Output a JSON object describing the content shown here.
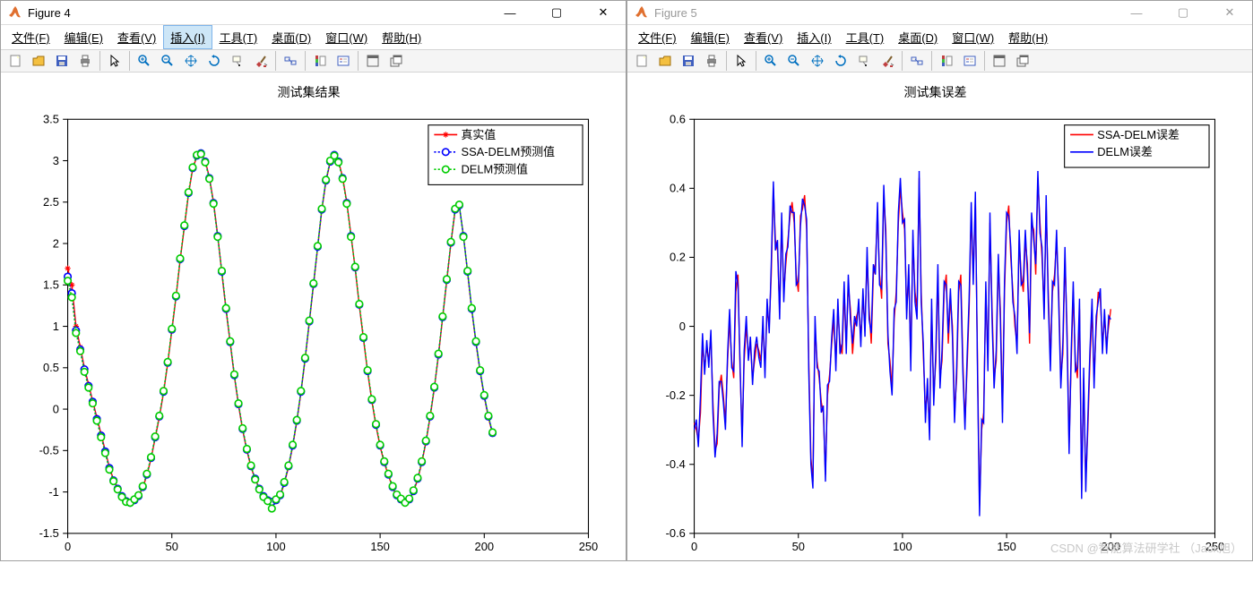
{
  "windows": [
    {
      "title": "Figure 4",
      "active": true,
      "plot_title": "测试集结果",
      "legend": [
        "真实值",
        "SSA-DELM预测值",
        "DELM预测值"
      ]
    },
    {
      "title": "Figure 5",
      "active": false,
      "plot_title": "测试集误差",
      "legend": [
        "SSA-DELM误差",
        "DELM误差"
      ]
    }
  ],
  "menu": {
    "file": "文件(F)",
    "edit": "编辑(E)",
    "view": "查看(V)",
    "insert": "插入(I)",
    "tools": "工具(T)",
    "desktop": "桌面(D)",
    "window": "窗口(W)",
    "help": "帮助(H)"
  },
  "win_controls": {
    "min": "—",
    "max": "▢",
    "close": "✕"
  },
  "watermark": "CSDN @智能算法研学社 （Jack旭）",
  "chart_data": [
    {
      "type": "line",
      "title": "测试集结果",
      "xlabel": "",
      "ylabel": "",
      "xlim": [
        0,
        250
      ],
      "ylim": [
        -1.5,
        3.5
      ],
      "xticks": [
        0,
        50,
        100,
        150,
        200,
        250
      ],
      "yticks": [
        -1.5,
        -1,
        -0.5,
        0,
        0.5,
        1,
        1.5,
        2,
        2.5,
        3,
        3.5
      ],
      "x": [
        0,
        2,
        4,
        6,
        8,
        10,
        12,
        14,
        16,
        18,
        20,
        22,
        24,
        26,
        28,
        30,
        32,
        34,
        36,
        38,
        40,
        42,
        44,
        46,
        48,
        50,
        52,
        54,
        56,
        58,
        60,
        62,
        64,
        66,
        68,
        70,
        72,
        74,
        76,
        78,
        80,
        82,
        84,
        86,
        88,
        90,
        92,
        94,
        96,
        98,
        100,
        102,
        104,
        106,
        108,
        110,
        112,
        114,
        116,
        118,
        120,
        122,
        124,
        126,
        128,
        130,
        132,
        134,
        136,
        138,
        140,
        142,
        144,
        146,
        148,
        150,
        152,
        154,
        156,
        158,
        160,
        162,
        164,
        166,
        168,
        170,
        172,
        174,
        176,
        178,
        180,
        182,
        184,
        186,
        188,
        190,
        192,
        194,
        196,
        198,
        200,
        202,
        204
      ],
      "series": [
        {
          "name": "真实值",
          "color": "#ff0000",
          "marker": "*",
          "values": [
            1.7,
            1.5,
            1.0,
            0.75,
            0.5,
            0.3,
            0.1,
            -0.1,
            -0.3,
            -0.5,
            -0.7,
            -0.85,
            -0.95,
            -1.05,
            -1.1,
            -1.12,
            -1.1,
            -1.05,
            -0.95,
            -0.8,
            -0.6,
            -0.35,
            -0.1,
            0.2,
            0.55,
            0.95,
            1.35,
            1.8,
            2.2,
            2.6,
            2.9,
            3.05,
            3.1,
            3.0,
            2.8,
            2.5,
            2.1,
            1.65,
            1.2,
            0.8,
            0.4,
            0.05,
            -0.25,
            -0.5,
            -0.7,
            -0.85,
            -0.95,
            -1.05,
            -1.1,
            -1.12,
            -1.1,
            -1.05,
            -0.9,
            -0.7,
            -0.45,
            -0.15,
            0.2,
            0.6,
            1.05,
            1.5,
            1.95,
            2.4,
            2.75,
            2.98,
            3.08,
            3.0,
            2.8,
            2.5,
            2.1,
            1.7,
            1.25,
            0.85,
            0.45,
            0.1,
            -0.2,
            -0.45,
            -0.65,
            -0.8,
            -0.95,
            -1.05,
            -1.1,
            -1.12,
            -1.1,
            -1.0,
            -0.85,
            -0.65,
            -0.4,
            -0.1,
            0.25,
            0.65,
            1.1,
            1.55,
            2.0,
            2.4,
            2.45,
            2.1,
            1.65,
            1.2,
            0.8,
            0.45,
            0.15,
            -0.1,
            -0.3
          ]
        },
        {
          "name": "SSA-DELM预测值",
          "color": "#0000ff",
          "marker": "o",
          "linestyle": "dotted",
          "values": [
            1.6,
            1.4,
            0.95,
            0.72,
            0.48,
            0.28,
            0.09,
            -0.12,
            -0.32,
            -0.51,
            -0.71,
            -0.86,
            -0.96,
            -1.05,
            -1.11,
            -1.13,
            -1.1,
            -1.05,
            -0.94,
            -0.79,
            -0.59,
            -0.34,
            -0.09,
            0.21,
            0.56,
            0.96,
            1.36,
            1.81,
            2.21,
            2.61,
            2.91,
            3.06,
            3.09,
            2.99,
            2.79,
            2.49,
            2.09,
            1.66,
            1.21,
            0.81,
            0.41,
            0.06,
            -0.24,
            -0.49,
            -0.69,
            -0.84,
            -0.96,
            -1.05,
            -1.1,
            -1.12,
            -1.1,
            -1.04,
            -0.89,
            -0.69,
            -0.44,
            -0.14,
            0.21,
            0.61,
            1.06,
            1.51,
            1.96,
            2.41,
            2.76,
            2.99,
            3.07,
            2.99,
            2.79,
            2.49,
            2.09,
            1.71,
            1.26,
            0.86,
            0.46,
            0.11,
            -0.19,
            -0.44,
            -0.64,
            -0.79,
            -0.94,
            -1.04,
            -1.09,
            -1.12,
            -1.09,
            -0.99,
            -0.84,
            -0.64,
            -0.39,
            -0.09,
            0.26,
            0.66,
            1.11,
            1.56,
            2.01,
            2.41,
            2.46,
            2.09,
            1.66,
            1.21,
            0.81,
            0.46,
            0.16,
            -0.09,
            -0.29
          ]
        },
        {
          "name": "DELM预测值",
          "color": "#00cc00",
          "marker": "o",
          "linestyle": "dotted",
          "values": [
            1.55,
            1.35,
            0.92,
            0.7,
            0.45,
            0.26,
            0.07,
            -0.14,
            -0.34,
            -0.53,
            -0.73,
            -0.87,
            -0.97,
            -1.06,
            -1.12,
            -1.13,
            -1.09,
            -1.04,
            -0.93,
            -0.78,
            -0.58,
            -0.33,
            -0.08,
            0.22,
            0.57,
            0.97,
            1.37,
            1.82,
            2.22,
            2.62,
            2.92,
            3.07,
            3.08,
            2.98,
            2.78,
            2.48,
            2.08,
            1.67,
            1.22,
            0.82,
            0.42,
            0.07,
            -0.23,
            -0.48,
            -0.68,
            -0.85,
            -0.97,
            -1.06,
            -1.11,
            -1.2,
            -1.09,
            -1.03,
            -0.88,
            -0.68,
            -0.43,
            -0.13,
            0.22,
            0.62,
            1.07,
            1.52,
            1.97,
            2.42,
            2.77,
            3.0,
            3.06,
            2.98,
            2.78,
            2.48,
            2.08,
            1.72,
            1.27,
            0.87,
            0.47,
            0.12,
            -0.18,
            -0.43,
            -0.63,
            -0.78,
            -0.93,
            -1.03,
            -1.08,
            -1.13,
            -1.08,
            -0.98,
            -0.83,
            -0.63,
            -0.38,
            -0.08,
            0.27,
            0.67,
            1.12,
            1.57,
            2.02,
            2.42,
            2.47,
            2.08,
            1.67,
            1.22,
            0.82,
            0.47,
            0.17,
            -0.08,
            -0.28
          ]
        }
      ]
    },
    {
      "type": "line",
      "title": "测试集误差",
      "xlabel": "",
      "ylabel": "",
      "xlim": [
        0,
        250
      ],
      "ylim": [
        -0.6,
        0.6
      ],
      "xticks": [
        0,
        50,
        100,
        150,
        200,
        250
      ],
      "yticks": [
        -0.6,
        -0.4,
        -0.2,
        0,
        0.2,
        0.4,
        0.6
      ],
      "x": [
        0,
        1,
        2,
        3,
        4,
        5,
        6,
        7,
        8,
        9,
        10,
        11,
        12,
        13,
        14,
        15,
        16,
        17,
        18,
        19,
        20,
        21,
        22,
        23,
        24,
        25,
        26,
        27,
        28,
        29,
        30,
        31,
        32,
        33,
        34,
        35,
        36,
        37,
        38,
        39,
        40,
        41,
        42,
        43,
        44,
        45,
        46,
        47,
        48,
        49,
        50,
        51,
        52,
        53,
        54,
        55,
        56,
        57,
        58,
        59,
        60,
        61,
        62,
        63,
        64,
        65,
        66,
        67,
        68,
        69,
        70,
        71,
        72,
        73,
        74,
        75,
        76,
        77,
        78,
        79,
        80,
        81,
        82,
        83,
        84,
        85,
        86,
        87,
        88,
        89,
        90,
        91,
        92,
        93,
        94,
        95,
        96,
        97,
        98,
        99,
        100,
        101,
        102,
        103,
        104,
        105,
        106,
        107,
        108,
        109,
        110,
        111,
        112,
        113,
        114,
        115,
        116,
        117,
        118,
        119,
        120,
        121,
        122,
        123,
        124,
        125,
        126,
        127,
        128,
        129,
        130,
        131,
        132,
        133,
        134,
        135,
        136,
        137,
        138,
        139,
        140,
        141,
        142,
        143,
        144,
        145,
        146,
        147,
        148,
        149,
        150,
        151,
        152,
        153,
        154,
        155,
        156,
        157,
        158,
        159,
        160,
        161,
        162,
        163,
        164,
        165,
        166,
        167,
        168,
        169,
        170,
        171,
        172,
        173,
        174,
        175,
        176,
        177,
        178,
        179,
        180,
        181,
        182,
        183,
        184,
        185,
        186,
        187,
        188,
        189,
        190,
        191,
        192,
        193,
        194,
        195,
        196,
        197,
        198,
        199,
        200
      ],
      "series": [
        {
          "name": "SSA-DELM误差",
          "color": "#ff0000",
          "values": [
            -0.28,
            -0.3,
            -0.33,
            -0.25,
            -0.05,
            -0.12,
            -0.06,
            -0.1,
            -0.03,
            -0.22,
            -0.36,
            -0.34,
            -0.18,
            -0.14,
            -0.2,
            -0.28,
            -0.1,
            0.02,
            -0.1,
            -0.15,
            0.1,
            0.15,
            -0.12,
            -0.32,
            -0.1,
            0.0,
            -0.08,
            -0.05,
            -0.15,
            -0.1,
            -0.05,
            -0.07,
            -0.1,
            0.0,
            -0.12,
            0.05,
            0.0,
            0.15,
            0.4,
            0.25,
            0.22,
            0.05,
            0.3,
            0.1,
            0.18,
            0.25,
            0.32,
            0.36,
            0.3,
            0.15,
            0.1,
            0.32,
            0.34,
            0.38,
            0.28,
            -0.1,
            -0.38,
            -0.45,
            0.0,
            -0.1,
            -0.15,
            -0.22,
            -0.25,
            -0.43,
            -0.2,
            -0.14,
            -0.05,
            0.02,
            -0.1,
            0.05,
            -0.05,
            -0.08,
            0.1,
            -0.05,
            0.12,
            0.05,
            -0.08,
            0.0,
            0.03,
            0.05,
            -0.03,
            0.08,
            0.0,
            0.2,
            0.05,
            -0.05,
            0.15,
            0.18,
            0.33,
            0.15,
            0.08,
            0.38,
            0.28,
            -0.05,
            -0.1,
            -0.18,
            0.02,
            0.1,
            0.3,
            0.4,
            0.33,
            0.28,
            0.05,
            0.15,
            -0.1,
            0.25,
            0.1,
            0.05,
            0.43,
            0.1,
            -0.08,
            -0.25,
            -0.18,
            -0.3,
            0.05,
            -0.2,
            -0.1,
            0.15,
            -0.15,
            -0.1,
            0.1,
            0.15,
            -0.05,
            0.08,
            0.0,
            -0.25,
            -0.15,
            0.1,
            0.15,
            -0.1,
            -0.28,
            -0.12,
            0.05,
            0.33,
            0.15,
            0.36,
            -0.1,
            -0.52,
            -0.3,
            -0.25,
            0.1,
            -0.1,
            0.3,
            0.05,
            -0.15,
            -0.1,
            0.18,
            0.05,
            -0.25,
            0.1,
            0.3,
            0.35,
            0.2,
            0.1,
            0.0,
            -0.05,
            0.25,
            0.15,
            0.1,
            0.25,
            0.18,
            -0.05,
            0.3,
            0.28,
            0.15,
            0.43,
            0.3,
            0.2,
            0.05,
            0.35,
            0.1,
            -0.1,
            0.1,
            0.15,
            0.25,
            0.1,
            -0.15,
            -0.08,
            0.2,
            0.0,
            -0.34,
            -0.1,
            0.1,
            -0.1,
            -0.15,
            0.05,
            -0.48,
            -0.15,
            -0.45,
            -0.3,
            -0.1,
            0.05,
            -0.15,
            0.0,
            0.1,
            0.08,
            -0.05,
            0.02,
            -0.05,
            0.0,
            0.05
          ]
        },
        {
          "name": "DELM误差",
          "color": "#0000ff",
          "values": [
            -0.3,
            -0.27,
            -0.35,
            -0.2,
            -0.02,
            -0.14,
            -0.04,
            -0.12,
            -0.01,
            -0.25,
            -0.38,
            -0.31,
            -0.16,
            -0.16,
            -0.22,
            -0.3,
            -0.08,
            0.05,
            -0.12,
            -0.13,
            0.16,
            0.12,
            -0.1,
            -0.35,
            -0.07,
            0.03,
            -0.1,
            -0.03,
            -0.17,
            -0.07,
            -0.03,
            -0.09,
            -0.12,
            0.03,
            -0.15,
            0.08,
            -0.02,
            0.18,
            0.42,
            0.22,
            0.25,
            0.02,
            0.33,
            0.07,
            0.21,
            0.23,
            0.35,
            0.33,
            0.33,
            0.12,
            0.13,
            0.29,
            0.37,
            0.35,
            0.31,
            -0.13,
            -0.4,
            -0.47,
            0.03,
            -0.12,
            -0.13,
            -0.25,
            -0.23,
            -0.45,
            -0.17,
            -0.16,
            -0.03,
            0.05,
            -0.13,
            0.08,
            -0.08,
            -0.05,
            0.13,
            -0.08,
            0.15,
            0.02,
            -0.05,
            0.03,
            0.0,
            0.08,
            -0.06,
            0.11,
            -0.03,
            0.23,
            0.02,
            -0.02,
            0.18,
            0.15,
            0.36,
            0.12,
            0.11,
            0.41,
            0.25,
            -0.02,
            -0.13,
            -0.2,
            0.05,
            0.07,
            0.33,
            0.43,
            0.3,
            0.31,
            0.02,
            0.18,
            -0.13,
            0.28,
            0.07,
            0.02,
            0.45,
            0.07,
            -0.05,
            -0.28,
            -0.15,
            -0.33,
            0.08,
            -0.23,
            -0.07,
            0.18,
            -0.18,
            -0.07,
            0.13,
            0.12,
            -0.02,
            0.11,
            -0.03,
            -0.28,
            -0.12,
            0.13,
            0.12,
            -0.13,
            -0.3,
            -0.09,
            0.08,
            0.36,
            0.12,
            0.39,
            -0.13,
            -0.55,
            -0.27,
            -0.28,
            0.13,
            -0.13,
            0.33,
            0.02,
            -0.18,
            -0.07,
            0.21,
            0.02,
            -0.28,
            0.13,
            0.33,
            0.32,
            0.23,
            0.07,
            0.03,
            -0.08,
            0.28,
            0.12,
            0.13,
            0.28,
            0.15,
            -0.02,
            0.33,
            0.25,
            0.18,
            0.45,
            0.27,
            0.23,
            0.02,
            0.38,
            0.07,
            -0.13,
            0.13,
            0.12,
            0.28,
            0.07,
            -0.18,
            -0.05,
            0.23,
            -0.03,
            -0.37,
            -0.07,
            0.13,
            -0.13,
            -0.12,
            0.08,
            -0.5,
            -0.12,
            -0.48,
            -0.27,
            -0.07,
            0.08,
            -0.18,
            0.03,
            0.07,
            0.11,
            -0.08,
            0.05,
            -0.08,
            0.03,
            0.02
          ]
        }
      ]
    }
  ]
}
